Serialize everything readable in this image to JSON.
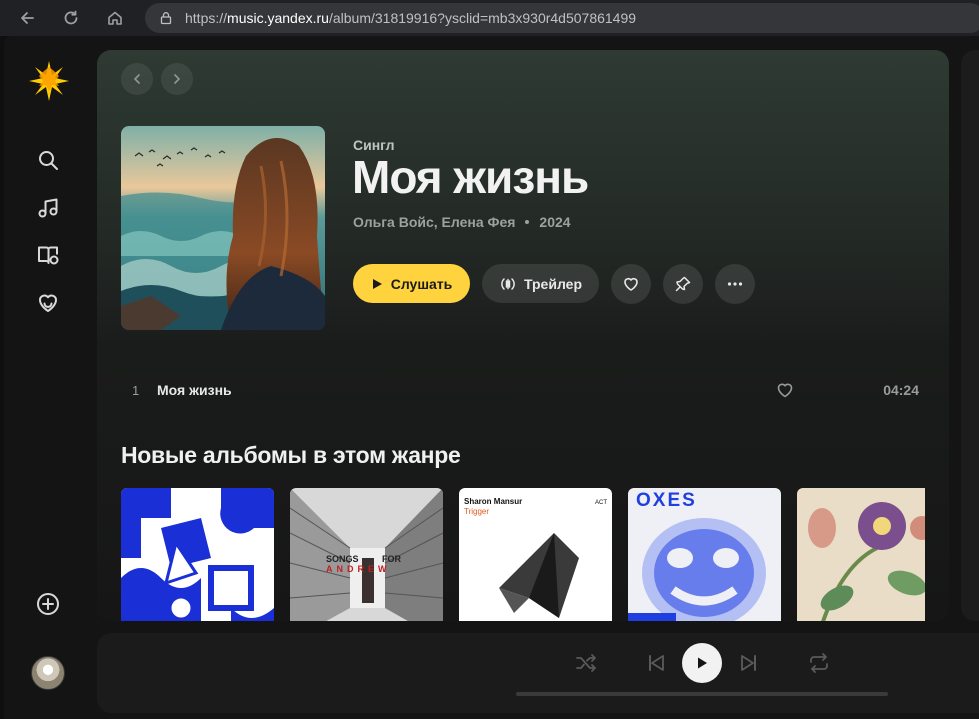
{
  "browser": {
    "url_prefix": "https://",
    "url_host": "music.yandex.ru",
    "url_path": "/album/31819916?ysclid=mb3x930r4d507861499"
  },
  "sidebar": {
    "items": [
      {
        "name": "search-icon"
      },
      {
        "name": "music-note-icon"
      },
      {
        "name": "library-icon"
      },
      {
        "name": "heart-smile-icon"
      }
    ],
    "bottom": [
      {
        "name": "add-circle-icon"
      }
    ]
  },
  "album": {
    "kind": "Сингл",
    "title": "Моя жизнь",
    "artists": "Ольга Войс, Елена Фея",
    "year": "2024",
    "play_label": "Слушать",
    "trailer_label": "Трейлер"
  },
  "tracks": [
    {
      "number": "1",
      "title": "Моя жизнь",
      "duration": "04:24"
    }
  ],
  "new_albums": {
    "title": "Новые альбомы в этом жанре",
    "items": [
      {
        "name": "album-cover-blue-pattern"
      },
      {
        "name": "album-cover-songs-for-andrew",
        "text_a": "SONGS",
        "text_b": "FOR",
        "text_c": "ANDREW"
      },
      {
        "name": "album-cover-trigger",
        "artist": "Sharon Mansur",
        "title": "Trigger",
        "label": "ACT"
      },
      {
        "name": "album-cover-blue-face"
      },
      {
        "name": "album-cover-flowers"
      }
    ]
  },
  "colors": {
    "accent": "#ffd33e",
    "background": "#141414"
  }
}
